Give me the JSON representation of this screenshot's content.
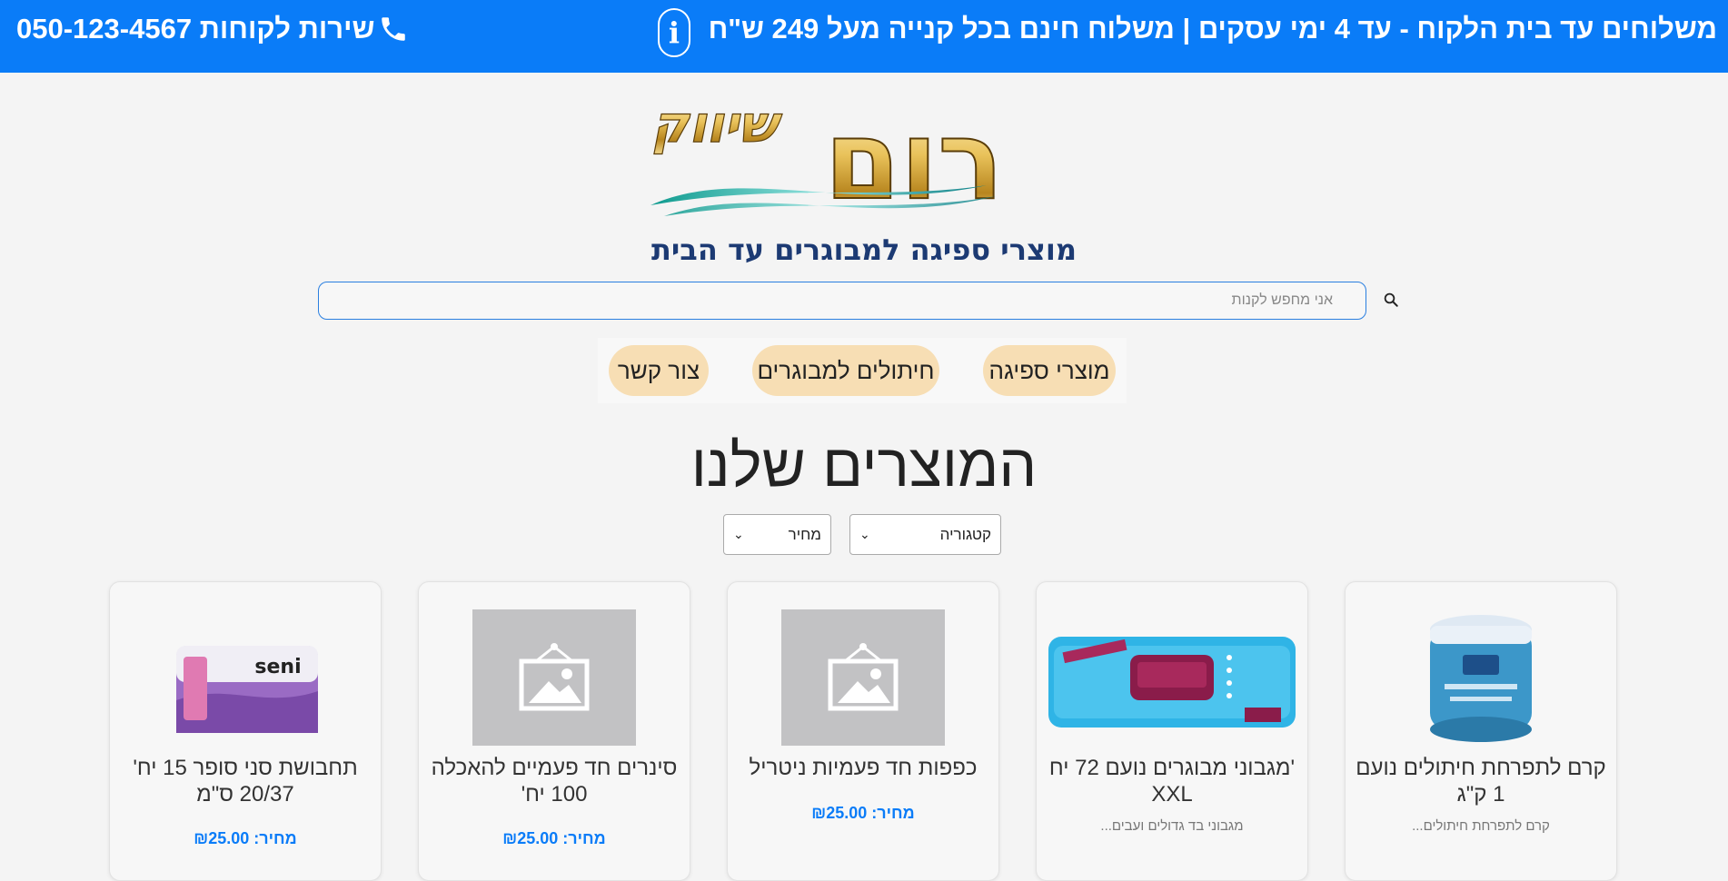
{
  "topbar": {
    "shipping_text": "משלוחים עד בית הלקוח - עד 4 ימי עסקים | משלוח חינם בכל קנייה מעל 249 ש\"ח",
    "info_icon": "info-icon",
    "phone_label": "שירות לקוחות 050-123-4567",
    "phone_icon": "phone-icon"
  },
  "logo": {
    "brand": "רום",
    "brand_sub": "שיווק",
    "tagline": "מוצרי ספיגה למבוגרים עד הבית"
  },
  "search": {
    "placeholder": "אני מחפש לקנות",
    "icon": "search-icon"
  },
  "nav": {
    "items": [
      {
        "label": "מוצרי ספיגה"
      },
      {
        "label": "חיתולים למבוגרים"
      },
      {
        "label": "צור קשר"
      }
    ]
  },
  "page_title": "המוצרים שלנו",
  "filters": {
    "category_label": "קטגוריה",
    "price_label": "מחיר"
  },
  "products": [
    {
      "name": "קרם לתפרחת חיתולים נועם 1 ק\"ג",
      "desc": "קרם לתפרחת חיתולים...",
      "price": "",
      "image": "cream-jar-image"
    },
    {
      "name": "'מגבוני מבוגרים נועם 72 יח XXL",
      "desc": "מגבוני בד גדולים ועבים...",
      "price": "",
      "image": "wipes-pack-image"
    },
    {
      "name": "כפפות חד פעמיות ניטריל",
      "desc": "",
      "price": "מחיר: ₪25.00",
      "image": "image-placeholder-icon"
    },
    {
      "name": "סינרים חד פעמיים להאכלה 100 יח'",
      "desc": "",
      "price": "מחיר: ₪25.00",
      "image": "image-placeholder-icon"
    },
    {
      "name": "תחבושת סני סופר 15 יח' 20/37 ס\"מ",
      "desc": "",
      "price": "מחיר: ₪25.00",
      "image": "seni-pads-image"
    }
  ],
  "colors": {
    "topbar": "#0a7cf8",
    "nav_pill": "#f7deb4",
    "price": "#0a7cf8",
    "placeholder_image": "#c2c2c4"
  }
}
